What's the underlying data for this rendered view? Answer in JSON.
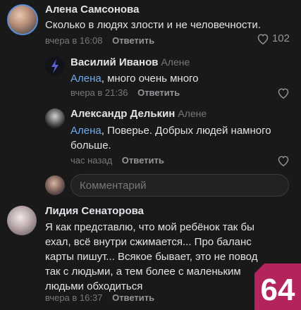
{
  "comments": [
    {
      "author": "Алена Самсонова",
      "text": "Сколько в людях злости и не человечности.",
      "time": "вчера в 16:08",
      "reply_label": "Ответить",
      "likes": "102"
    }
  ],
  "replies": [
    {
      "author": "Василий Иванов",
      "reply_to": "Алене",
      "mention": "Алена",
      "text": ", много очень много",
      "time": "вчера в 21:36",
      "reply_label": "Ответить"
    },
    {
      "author": "Александр Делькин",
      "reply_to": "Алене",
      "mention": "Алена",
      "text_line1": ", Поверье. Добрых людей намного",
      "text_line2": "больше.",
      "time": "час назад",
      "reply_label": "Ответить"
    }
  ],
  "comment_input": {
    "placeholder": "Комментарий"
  },
  "second_comment": {
    "author": "Лидия Сенаторова",
    "lines": [
      "Я как представлю, что мой ребёнок так бы",
      "ехал, всё внутри сжимается... Про баланс",
      "карты пишут... Всякое бывает, это не повод",
      "так с людьми, а тем более с маленьким",
      "людьми обходиться"
    ],
    "time": "вчера в 16:37",
    "reply_label": "Ответить"
  },
  "badge": {
    "text": "64",
    "color": "#b3245c"
  },
  "icons": {
    "like": "heart-icon"
  }
}
